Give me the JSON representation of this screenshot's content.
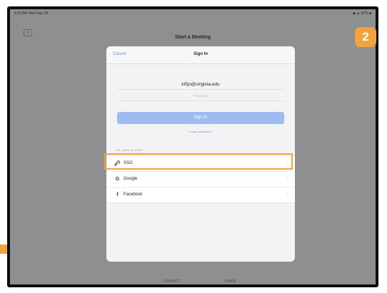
{
  "status_bar": {
    "left": "9:10 AM  Wed Sep 29",
    "right": "◆ ▲ 47% ■"
  },
  "background": {
    "top_icon": "⚙",
    "title": "Start a Meeting",
    "bottom_left": "CONNECT",
    "bottom_right": "SHARE"
  },
  "modal": {
    "cancel_label": "Cancel",
    "title": "Sign In",
    "email": "kt5jn@virginia.edu",
    "password_placeholder": "Password",
    "signin_label": "Sign In",
    "forgot_label": "Forgot password?",
    "or_label": "OR, SIGN IN WITH",
    "options": [
      {
        "label": "SSO",
        "icon": "key-icon",
        "glyph": "🔑︎"
      },
      {
        "label": "Google",
        "icon": "google-icon",
        "glyph": "G"
      },
      {
        "label": "Facebook",
        "icon": "facebook-icon",
        "glyph": "f"
      }
    ],
    "chevron": "›"
  },
  "annotation": {
    "step": "2",
    "highlight_color": "#f1a23c"
  }
}
